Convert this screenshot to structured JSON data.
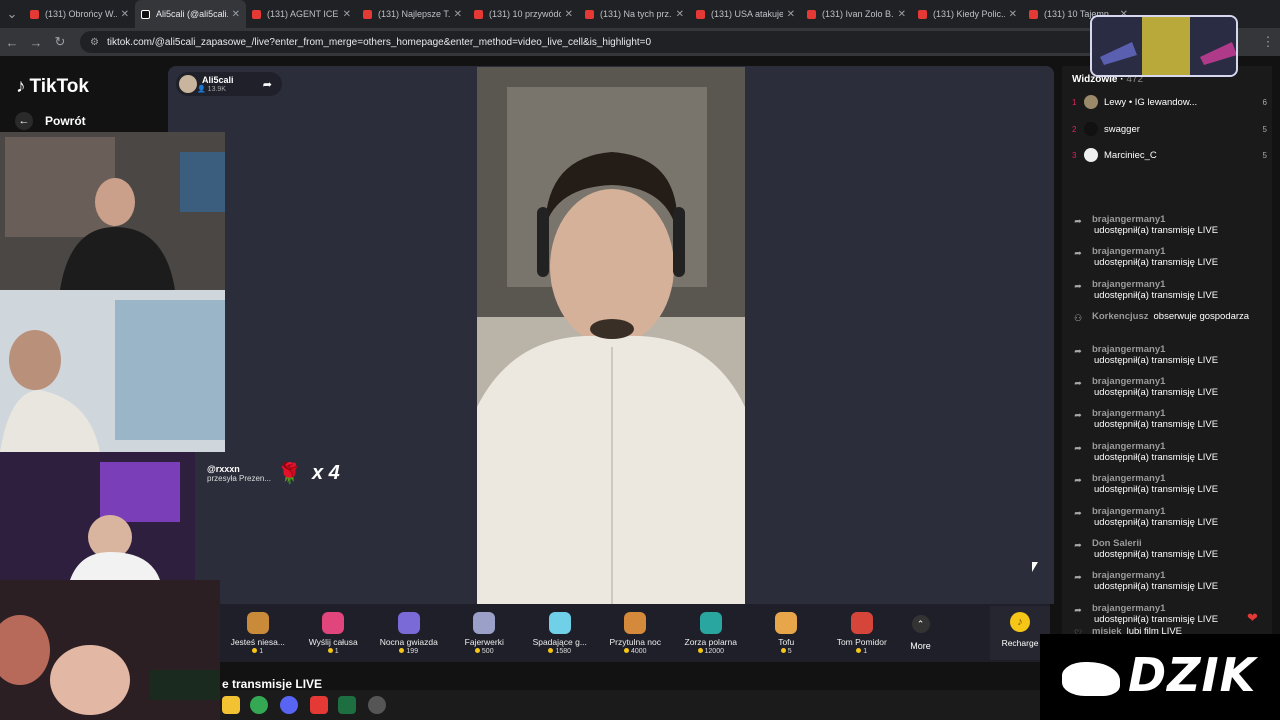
{
  "browser": {
    "tabs": [
      {
        "title": "(131) Obrońcy W..."
      },
      {
        "title": "Ali5cali (@ali5cali..."
      },
      {
        "title": "(131) AGENT ICE..."
      },
      {
        "title": "(131) Najlepsze T..."
      },
      {
        "title": "(131) 10 przywódc..."
      },
      {
        "title": "(131) Na tych prz..."
      },
      {
        "title": "(131) USA atakuje..."
      },
      {
        "title": "(131) Ivan Zolo B..."
      },
      {
        "title": "(131) Kiedy Polic..."
      },
      {
        "title": "(131) 10 Tajemn..."
      }
    ],
    "url": "tiktok.com/@ali5cali_zapasowe_/live?enter_from_merge=others_homepage&enter_method=video_live_cell&is_highlight=0"
  },
  "app": {
    "logo": "TikTok",
    "back_label": "Powrót"
  },
  "host": {
    "name": "Ali5cali",
    "viewers": "13.9K"
  },
  "gift_popup": {
    "user": "@rxxxn",
    "message": "przesyła Prezen...",
    "count": "x 4"
  },
  "gifts": [
    {
      "name": "Jesteś niesa...",
      "price": "1",
      "color": "#c98a3a"
    },
    {
      "name": "Wyślij całusa",
      "price": "1",
      "color": "#e0457b"
    },
    {
      "name": "Nocna gwiazda",
      "price": "199",
      "color": "#7a6ad8"
    },
    {
      "name": "Fajerwerki",
      "price": "500",
      "color": "#9aa0c8"
    },
    {
      "name": "Spadające g...",
      "price": "1580",
      "color": "#6fd0e8"
    },
    {
      "name": "Przytulna noc",
      "price": "4000",
      "color": "#d48a3a"
    },
    {
      "name": "Zorza polarna",
      "price": "12000",
      "color": "#2aa6a0"
    },
    {
      "name": "Tofu",
      "price": "5",
      "color": "#e8a64a"
    },
    {
      "name": "Tom Pomidor",
      "price": "1",
      "color": "#d6453a"
    }
  ],
  "more_label": "More",
  "recharge_label": "Recharge",
  "bottom_text": "e transmisje LIVE",
  "viewers_panel": {
    "title": "Widzowie",
    "count": "472",
    "top": [
      {
        "rank": "1",
        "name": "Lewy • IG lewandow...",
        "score": "6"
      },
      {
        "rank": "2",
        "name": "swagger",
        "score": "5"
      },
      {
        "rank": "3",
        "name": "Marciniec_C",
        "score": "5"
      }
    ]
  },
  "chat": [
    {
      "user": "brajangermany1",
      "msg": "udostępnił(a) transmisję LIVE",
      "icon": "share"
    },
    {
      "user": "brajangermany1",
      "msg": "udostępnił(a) transmisję LIVE",
      "icon": "share"
    },
    {
      "user": "brajangermany1",
      "msg": "udostępnił(a) transmisję LIVE",
      "icon": "share"
    },
    {
      "user": "Korkencjusz",
      "msg": "obserwuje gospodarza",
      "icon": "follow"
    },
    {
      "user": "brajangermany1",
      "msg": "udostępnił(a) transmisję LIVE",
      "icon": "share"
    },
    {
      "user": "brajangermany1",
      "msg": "udostępnił(a) transmisję LIVE",
      "icon": "share"
    },
    {
      "user": "brajangermany1",
      "msg": "udostępnił(a) transmisję LIVE",
      "icon": "share"
    },
    {
      "user": "brajangermany1",
      "msg": "udostępnił(a) transmisję LIVE",
      "icon": "share"
    },
    {
      "user": "brajangermany1",
      "msg": "udostępnił(a) transmisję LIVE",
      "icon": "share"
    },
    {
      "user": "brajangermany1",
      "msg": "udostępnił(a) transmisję LIVE",
      "icon": "share"
    },
    {
      "user": "Don Salerii",
      "msg": "udostępnił(a) transmisję LIVE",
      "icon": "share"
    },
    {
      "user": "brajangermany1",
      "msg": "udostępnił(a) transmisję LIVE",
      "icon": "share"
    },
    {
      "user": "brajangermany1",
      "msg": "udostępnił(a) transmisję LIVE",
      "icon": "share"
    },
    {
      "user": "brajangermany1",
      "msg": "udostępnił(a) transmisję LIVE",
      "icon": "share"
    }
  ],
  "chat_last": {
    "user": "misiek",
    "msg": "lubi film LIVE"
  },
  "watermark": "DZIK",
  "colors": {
    "brand": "#fe2c55",
    "stage_bg": "#2b2d3a",
    "coin": "#f5c518"
  }
}
